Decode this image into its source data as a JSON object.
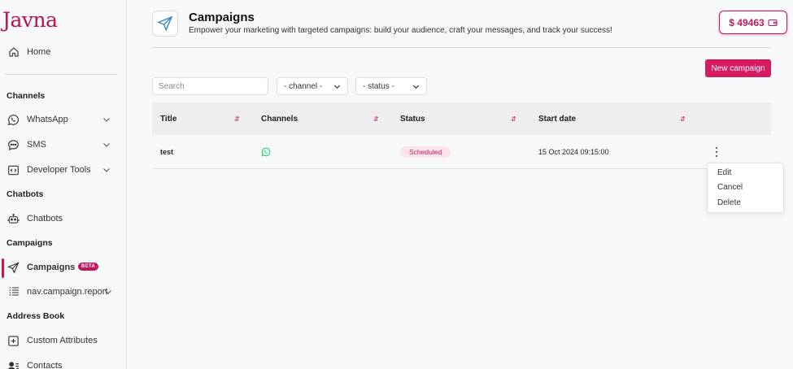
{
  "brand": {
    "logo_text": "Javna",
    "accent_color": "#c2185b"
  },
  "sidebar": {
    "home": "Home",
    "sections": {
      "channels": "Channels",
      "chatbots": "Chatbots",
      "campaigns": "Campaigns",
      "address_book": "Address Book"
    },
    "items": {
      "whatsapp": "WhatsApp",
      "sms": "SMS",
      "developer_tools": "Developer Tools",
      "chatbots": "Chatbots",
      "campaigns": "Campaigns",
      "campaigns_badge": "BETA",
      "campaign_report": "nav.campaign.report",
      "custom_attributes": "Custom Attributes",
      "contacts": "Contacts"
    }
  },
  "header": {
    "title": "Campaigns",
    "subtitle": "Empower your marketing with targeted campaigns: build your audience, craft your messages, and track your success!",
    "balance": "$ 49463"
  },
  "toolbar": {
    "new_campaign": "New campaign",
    "search_placeholder": "Search",
    "channel_filter": "- channel -",
    "status_filter": "- status -"
  },
  "table": {
    "columns": [
      "Title",
      "Channels",
      "Status",
      "Start date"
    ],
    "rows": [
      {
        "title": "test",
        "channel_icon": "whatsapp-icon",
        "status": "Scheduled",
        "start_date": "15 Oct 2024 09:15:00"
      }
    ]
  },
  "row_menu": {
    "items": [
      "Edit",
      "Cancel",
      "Delete"
    ]
  },
  "colors": {
    "status_scheduled_bg": "#fce4ec",
    "whatsapp_green": "#25d366"
  }
}
